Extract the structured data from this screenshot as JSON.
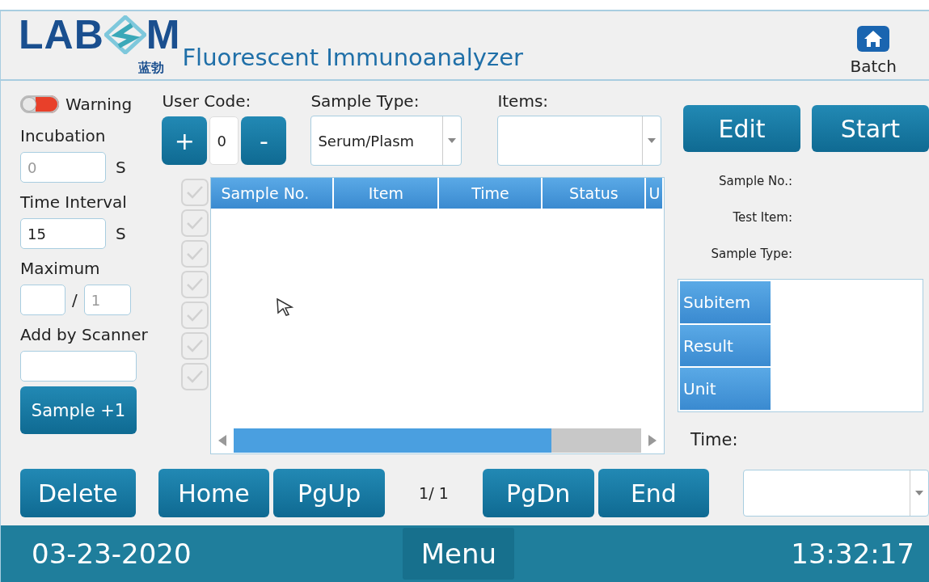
{
  "header": {
    "logo": {
      "letters_left": "LAB",
      "letters_right": "M",
      "subtitle": "蓝勃"
    },
    "title": "Fluorescent Immunoanalyzer",
    "batch_button": "Batch"
  },
  "left_panel": {
    "warning_toggle": {
      "label": "Warning",
      "on": false
    },
    "incubation": {
      "label": "Incubation",
      "placeholder": "0",
      "unit": "S"
    },
    "time_interval": {
      "label": "Time Interval",
      "value": "15",
      "unit": "S"
    },
    "maximum": {
      "label": "Maximum",
      "separator": "/",
      "placeholder": "1"
    },
    "scanner": {
      "label": "Add by Scanner"
    },
    "sample_button": "Sample +1"
  },
  "user_code": {
    "label": "User Code:",
    "plus": "+",
    "value": "0",
    "minus": "-"
  },
  "sample_type": {
    "label": "Sample Type:",
    "value": "Serum/Plasm"
  },
  "items": {
    "label": "Items:"
  },
  "table": {
    "columns": [
      "Sample No.",
      "Item",
      "Time",
      "Status",
      "U"
    ]
  },
  "row_checkboxes": [
    {
      "checked": false
    },
    {
      "checked": false
    },
    {
      "checked": false
    },
    {
      "checked": false
    },
    {
      "checked": false
    },
    {
      "checked": false
    },
    {
      "checked": false
    }
  ],
  "right_panel": {
    "buttons": [
      "Edit",
      "Start"
    ],
    "info_labels": [
      "Sample No.:",
      "Test Item:",
      "Sample Type:"
    ],
    "result_rows": [
      "Subitem",
      "Result",
      "Unit"
    ],
    "time_label": "Time:"
  },
  "bottom_bar": {
    "delete": "Delete",
    "nav": [
      {
        "kind": "button",
        "label": "Home"
      },
      {
        "kind": "button",
        "label": "PgUp"
      },
      {
        "kind": "page",
        "label": "1/ 1"
      },
      {
        "kind": "button",
        "label": "PgDn"
      },
      {
        "kind": "button",
        "label": "End"
      }
    ]
  },
  "status_bar": {
    "date": "03-23-2020",
    "menu": "Menu",
    "time": "13:32:17"
  }
}
